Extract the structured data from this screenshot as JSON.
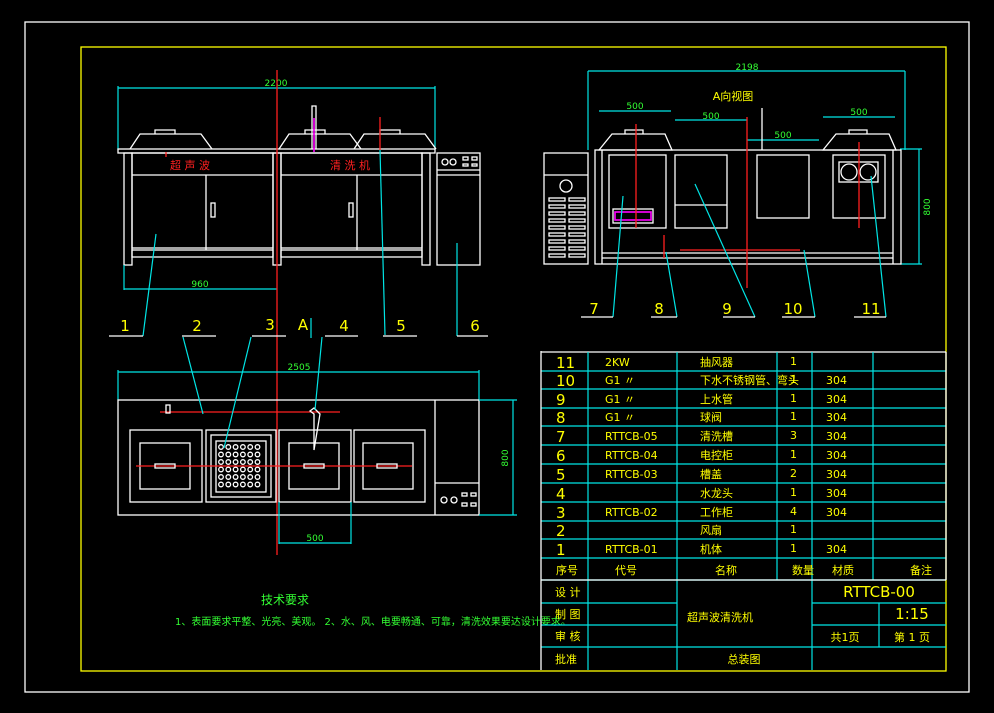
{
  "drawing": {
    "front_view": {
      "dim_width": "2200",
      "dim_half": "960",
      "label_ultrasonic": "超 声 波",
      "label_cleaner": "清 洗 机"
    },
    "side_view": {
      "title": "A向视图",
      "dim_width": "2198",
      "dim_height": "800",
      "dim_tank1": "500",
      "dim_tank2": "500",
      "dim_tank3": "500",
      "dim_tank4": "500"
    },
    "top_view": {
      "dim_width": "2505",
      "dim_depth": "800",
      "dim_tank": "500",
      "view_marker": "A"
    },
    "callouts_top": [
      "1",
      "2",
      "3",
      "4",
      "5",
      "6"
    ],
    "callouts_side": [
      "7",
      "8",
      "9",
      "10",
      "11"
    ],
    "tech_requirements": {
      "title": "技术要求",
      "text": "1、表面要求平整、光亮、美观。   2、水、风、电要畅通、可靠，清洗效果要达设计要求。"
    }
  },
  "parts_table": {
    "header": [
      "序号",
      "代号",
      "名称",
      "数量",
      "材质",
      "备注"
    ],
    "rows": [
      {
        "no": "11",
        "code": "2KW",
        "name": "抽风器",
        "qty": "1",
        "material": "",
        "note": ""
      },
      {
        "no": "10",
        "code": "G1 〃",
        "name": "下水不锈钢管、弯头",
        "qty": "1",
        "material": "304",
        "note": ""
      },
      {
        "no": "9",
        "code": "G1 〃",
        "name": "上水管",
        "qty": "1",
        "material": "304",
        "note": ""
      },
      {
        "no": "8",
        "code": "G1 〃",
        "name": "球阀",
        "qty": "1",
        "material": "304",
        "note": ""
      },
      {
        "no": "7",
        "code": "RTTCB-05",
        "name": "清洗槽",
        "qty": "3",
        "material": "304",
        "note": ""
      },
      {
        "no": "6",
        "code": "RTTCB-04",
        "name": "电控柜",
        "qty": "1",
        "material": "304",
        "note": ""
      },
      {
        "no": "5",
        "code": "RTTCB-03",
        "name": "槽盖",
        "qty": "2",
        "material": "304",
        "note": ""
      },
      {
        "no": "4",
        "code": "",
        "name": "水龙头",
        "qty": "1",
        "material": "304",
        "note": ""
      },
      {
        "no": "3",
        "code": "RTTCB-02",
        "name": "工作柜",
        "qty": "4",
        "material": "304",
        "note": ""
      },
      {
        "no": "2",
        "code": "",
        "name": "风扇",
        "qty": "1",
        "material": "",
        "note": ""
      },
      {
        "no": "1",
        "code": "RTTCB-01",
        "name": "机体",
        "qty": "1",
        "material": "304",
        "note": ""
      }
    ]
  },
  "title_block": {
    "design": "设 计",
    "drawing": "制 图",
    "review": "审 核",
    "approve": "批准",
    "product_name": "超声波清洗机",
    "drawing_type": "总装图",
    "drawing_no": "RTTCB-00",
    "scale": "1:15",
    "total_pages": "共1页",
    "page": "第 1 页"
  }
}
